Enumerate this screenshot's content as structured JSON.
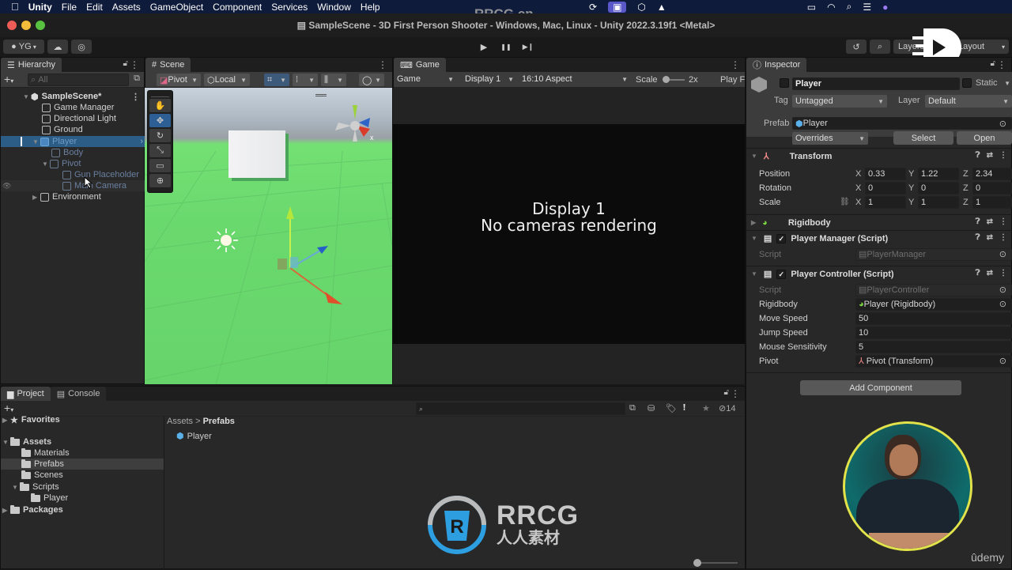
{
  "menubar": {
    "apple_icon": "apple-logo",
    "items": [
      "Unity",
      "File",
      "Edit",
      "Assets",
      "GameObject",
      "Component",
      "Services",
      "Window",
      "Help"
    ],
    "tray_icons": [
      "sync-icon",
      "screen-share-icon",
      "unity-icon",
      "vlc-icon",
      "battery-icon",
      "wifi-icon",
      "spotlight-icon",
      "control-center-icon",
      "siri-icon"
    ]
  },
  "window": {
    "title": "SampleScene - 3D First Person Shooter - Windows, Mac, Linux - Unity 2022.3.19f1 <Metal>"
  },
  "toolbar": {
    "account": "YG",
    "layers_label": "Layers",
    "layout_label": "Layout",
    "play_icon": "▶",
    "pause_icon": "❚❚",
    "step_icon": "▶❙"
  },
  "hierarchy": {
    "tab": "Hierarchy",
    "search_placeholder": "All",
    "scene": "SampleScene*",
    "items": [
      {
        "label": "Game Manager",
        "depth": 1
      },
      {
        "label": "Directional Light",
        "depth": 1
      },
      {
        "label": "Ground",
        "depth": 1
      },
      {
        "label": "Player",
        "depth": 1,
        "selected": true,
        "expanded": true
      },
      {
        "label": "Body",
        "depth": 2
      },
      {
        "label": "Pivot",
        "depth": 2,
        "expanded": true
      },
      {
        "label": "Gun Placeholder",
        "depth": 3
      },
      {
        "label": "Main Camera",
        "depth": 3
      },
      {
        "label": "Environment",
        "depth": 1,
        "collapsed": true
      }
    ]
  },
  "scene": {
    "tab": "Scene",
    "pivot": "Pivot",
    "local": "Local",
    "gizmo_axis": "x"
  },
  "game": {
    "tab": "Game",
    "mode": "Game",
    "display": "Display 1",
    "aspect": "16:10 Aspect",
    "scale_label": "Scale",
    "scale_value": "2x",
    "play_focus": "Play F",
    "message_line1": "Display 1",
    "message_line2": "No cameras rendering"
  },
  "inspector": {
    "tab": "Inspector",
    "object_name": "Player",
    "static_label": "Static",
    "tag_label": "Tag",
    "tag_value": "Untagged",
    "layer_label": "Layer",
    "layer_value": "Default",
    "prefab_label": "Prefab",
    "prefab_value": "Player",
    "overrides": "Overrides",
    "select": "Select",
    "open": "Open",
    "transform": {
      "title": "Transform",
      "position_label": "Position",
      "position": {
        "x": "0.33",
        "y": "1.22",
        "z": "2.34"
      },
      "rotation_label": "Rotation",
      "rotation": {
        "x": "0",
        "y": "0",
        "z": "0"
      },
      "scale_label": "Scale",
      "scale": {
        "x": "1",
        "y": "1",
        "z": "1"
      }
    },
    "rigidbody": {
      "title": "Rigidbody"
    },
    "player_manager": {
      "title": "Player Manager (Script)",
      "script_label": "Script",
      "script_value": "PlayerManager"
    },
    "player_controller": {
      "title": "Player Controller (Script)",
      "script_label": "Script",
      "script_value": "PlayerController",
      "rigidbody_label": "Rigidbody",
      "rigidbody_value": "Player (Rigidbody)",
      "move_speed_label": "Move Speed",
      "move_speed": "50",
      "jump_speed_label": "Jump Speed",
      "jump_speed": "10",
      "mouse_sens_label": "Mouse Sensitivity",
      "mouse_sens": "5",
      "pivot_label": "Pivot",
      "pivot_value": "Pivot (Transform)"
    },
    "add_component": "Add Component"
  },
  "project": {
    "tab_project": "Project",
    "tab_console": "Console",
    "favorites": "Favorites",
    "assets": "Assets",
    "folders": [
      "Materials",
      "Prefabs",
      "Scenes",
      "Scripts"
    ],
    "scripts_child": "Player",
    "packages": "Packages",
    "breadcrumb": [
      "Assets",
      "Prefabs"
    ],
    "files": [
      "Player"
    ],
    "hidden_count": "14"
  },
  "overlays": {
    "watermark_top": "RRCG.cn",
    "logo_text": "RRCG",
    "logo_sub": "人人素材",
    "udemy": "ûdemy"
  }
}
